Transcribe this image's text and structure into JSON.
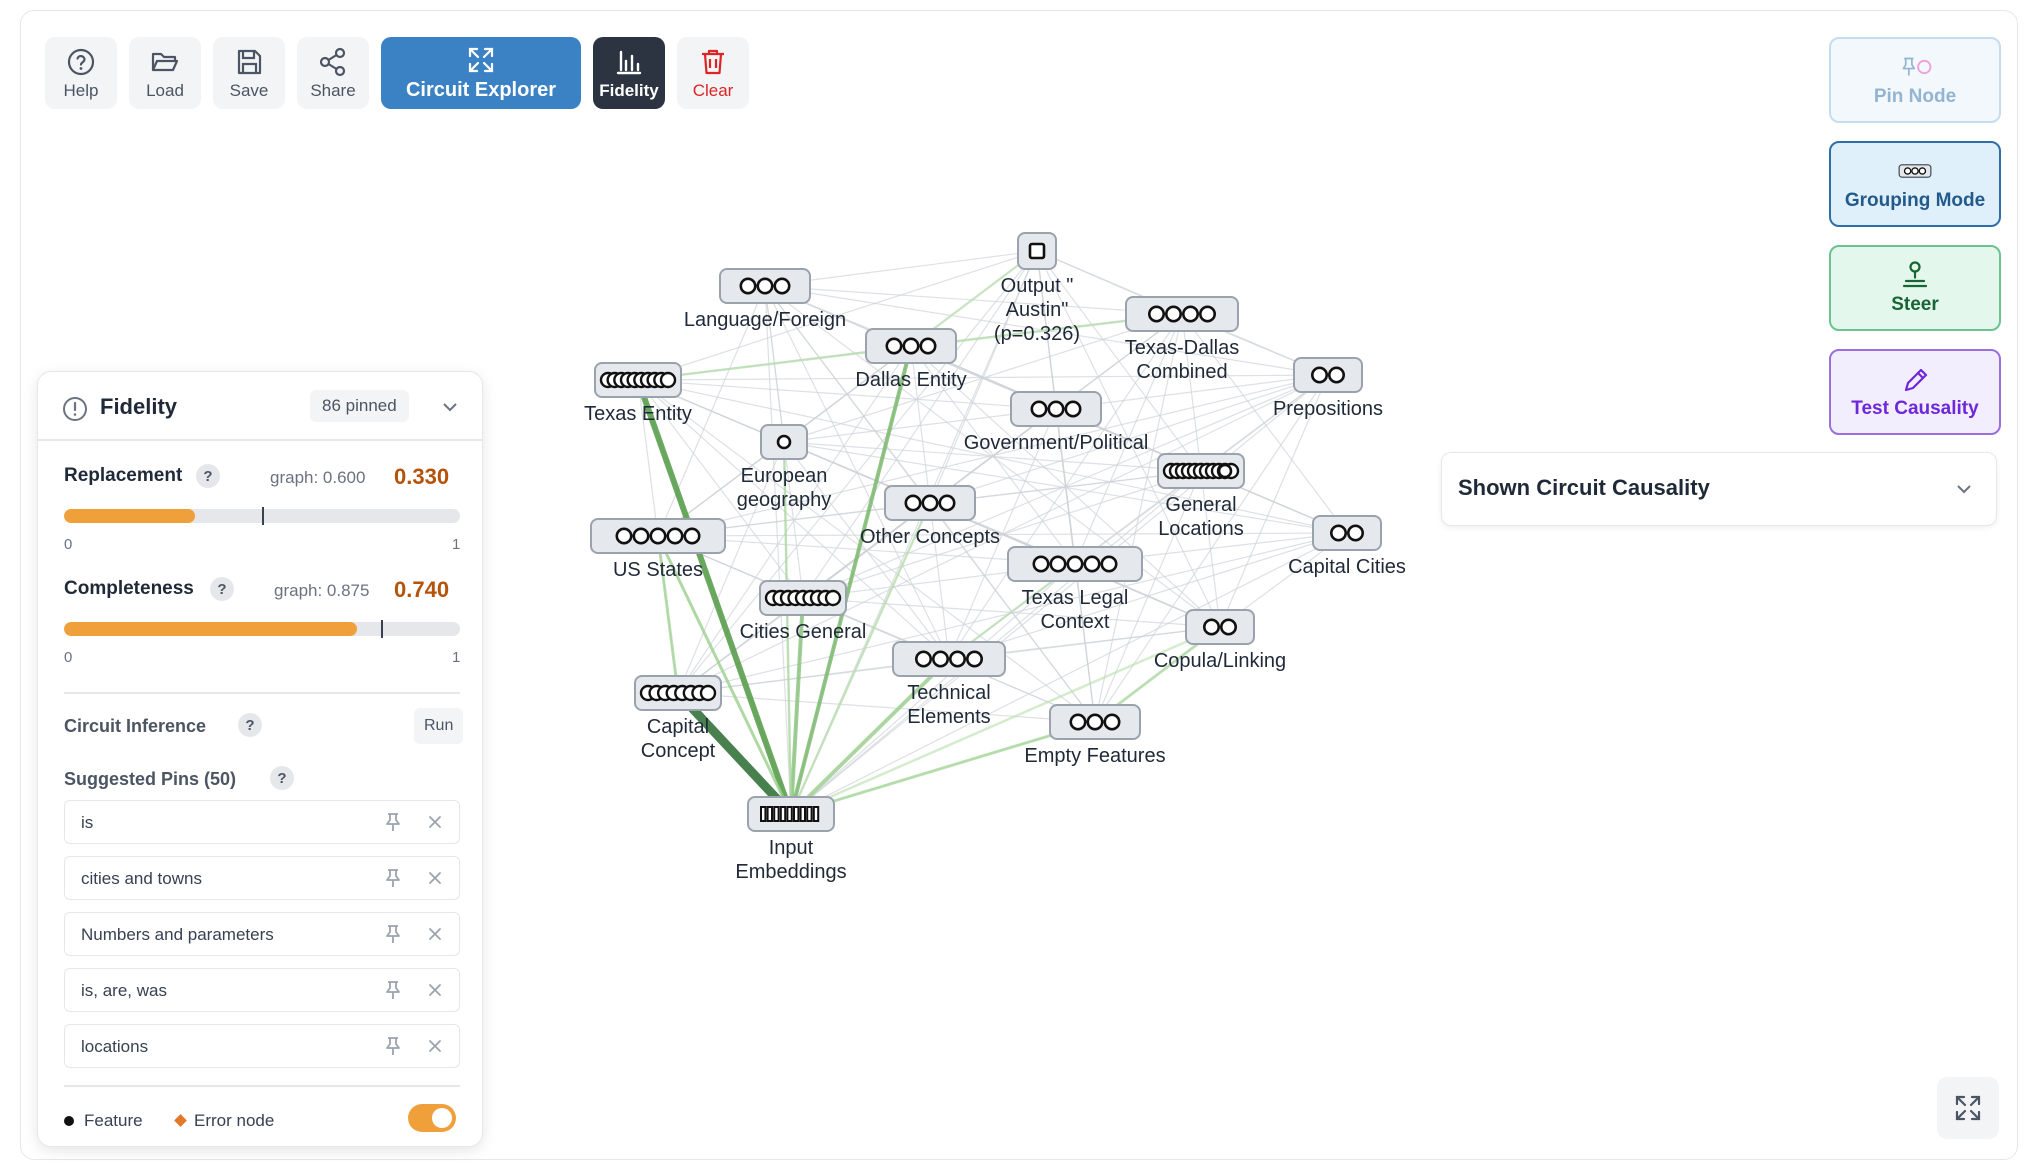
{
  "toolbar": {
    "help": "Help",
    "load": "Load",
    "save": "Save",
    "share": "Share",
    "circuit_explorer": "Circuit Explorer",
    "fidelity": "Fidelity",
    "clear": "Clear"
  },
  "actions": {
    "pin_node": "Pin Node",
    "grouping_mode": "Grouping Mode",
    "steer": "Steer",
    "test_causality": "Test Causality"
  },
  "causality_panel": {
    "title": "Shown Circuit Causality"
  },
  "fidelity": {
    "title": "Fidelity",
    "pinned_badge": "86 pinned",
    "replacement": {
      "label": "Replacement",
      "help": "?",
      "graph_text": "graph: 0.600",
      "value_text": "0.330",
      "value": 0.33,
      "graph_marker": 0.5,
      "min": "0",
      "max": "1"
    },
    "completeness": {
      "label": "Completeness",
      "help": "?",
      "graph_text": "graph: 0.875",
      "value_text": "0.740",
      "value": 0.74,
      "graph_marker": 0.8,
      "min": "0",
      "max": "1"
    },
    "circuit_inference": {
      "label": "Circuit Inference",
      "help": "?",
      "run": "Run"
    },
    "suggested_pins": {
      "label": "Suggested Pins (50)",
      "help": "?",
      "items": [
        "is",
        "cities and towns",
        "Numbers and parameters",
        "is, are, was",
        "locations"
      ]
    },
    "legend": {
      "feature": "Feature",
      "error_node": "Error node",
      "toggle_on": true
    }
  },
  "colors": {
    "accent": "#3b82c4",
    "warn_bar": "#f0a03a",
    "edge_green": "#5a9e4e",
    "edge_gray": "#d1d5db"
  },
  "graph": {
    "nodes": [
      {
        "id": "language",
        "label": [
          "Language/Foreign"
        ],
        "circles": 3
      },
      {
        "id": "output",
        "label": [
          "Output \"",
          "Austin\"",
          "(p=0.326)"
        ],
        "circles": 0
      },
      {
        "id": "texas_dallas",
        "label": [
          "Texas-Dallas",
          "Combined"
        ],
        "circles": 4
      },
      {
        "id": "dallas",
        "label": [
          "Dallas Entity"
        ],
        "circles": 3
      },
      {
        "id": "texas",
        "label": [
          "Texas Entity"
        ],
        "circles": 8
      },
      {
        "id": "prepositions",
        "label": [
          "Prepositions"
        ],
        "circles": 2
      },
      {
        "id": "government",
        "label": [
          "Government/Political"
        ],
        "circles": 3
      },
      {
        "id": "european",
        "label": [
          "European",
          "geography"
        ],
        "circles": 1
      },
      {
        "id": "general_loc",
        "label": [
          "General",
          "Locations"
        ],
        "circles": 9
      },
      {
        "id": "other",
        "label": [
          "Other Concepts"
        ],
        "circles": 3
      },
      {
        "id": "us_states",
        "label": [
          "US States"
        ],
        "circles": 5
      },
      {
        "id": "capital_cities",
        "label": [
          "Capital Cities"
        ],
        "circles": 2
      },
      {
        "id": "texas_legal",
        "label": [
          "Texas Legal",
          "Context"
        ],
        "circles": 5
      },
      {
        "id": "cities_general",
        "label": [
          "Cities General"
        ],
        "circles": 7
      },
      {
        "id": "copula",
        "label": [
          "Copula/Linking"
        ],
        "circles": 2
      },
      {
        "id": "technical",
        "label": [
          "Technical",
          "Elements"
        ],
        "circles": 4
      },
      {
        "id": "capital_concept",
        "label": [
          "Capital",
          "Concept"
        ],
        "circles": 6
      },
      {
        "id": "empty",
        "label": [
          "Empty Features"
        ],
        "circles": 3
      },
      {
        "id": "input",
        "label": [
          "Input",
          "Embeddings"
        ],
        "circles": -1
      }
    ]
  }
}
